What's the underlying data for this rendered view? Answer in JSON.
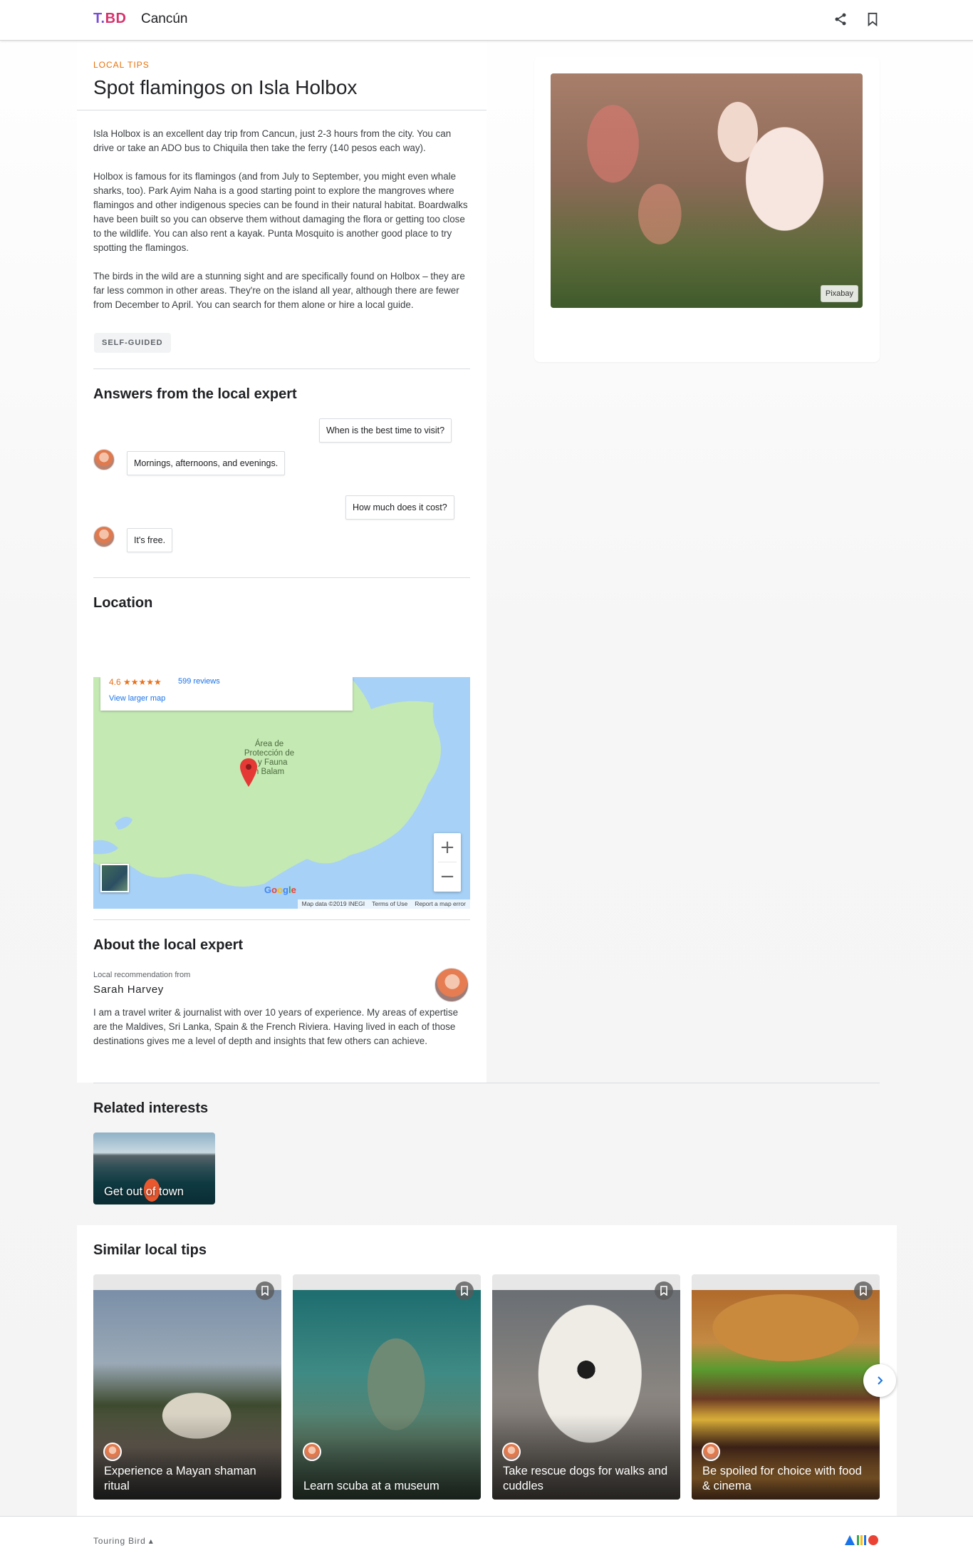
{
  "header": {
    "logo": {
      "t": "T.",
      "bd": "BD"
    },
    "city": "Cancún",
    "share_icon": "share-icon",
    "bookmark_icon": "bookmark-icon"
  },
  "article": {
    "eyebrow": "LOCAL TIPS",
    "title": "Spot flamingos on Isla Holbox",
    "paragraphs": [
      "Isla Holbox is an excellent day trip from Cancun, just 2-3 hours from the city. You can drive or take an ADO bus to Chiquila then take the ferry (140 pesos each way).",
      "Holbox is famous for its flamingos (and from July to September, you might even whale sharks, too). Park Ayim Naha is a good starting point to explore the mangroves where flamingos and other indigenous species can be found in their natural habitat. Boardwalks have been built so you can observe them without damaging the flora or getting too close to the wildlife. You can also rent a kayak. Punta Mosquito is another good place to try spotting the flamingos.",
      "The birds in the wild are a stunning sight and are specifically found on Holbox – they are far less common in other areas. They're on the island all year, although there are fewer from December to April. You can search for them alone or hire a local guide."
    ],
    "tag": "SELF-GUIDED"
  },
  "qa": {
    "title": "Answers from the local expert",
    "items": [
      {
        "q": "When is the best time to visit?",
        "a": "Mornings, afternoons, and evenings."
      },
      {
        "q": "How much does it cost?",
        "a": "It's free."
      }
    ]
  },
  "location": {
    "title": "Location",
    "rating": "4.6 ★★★★★",
    "reviews": "599 reviews",
    "larger_map": "View larger map",
    "place_lines": [
      "Área de",
      "Protección de",
      "a y Fauna",
      "n Balam"
    ],
    "google": "Google",
    "map_data": "Map data ©2019 INEGI",
    "terms": "Terms of Use",
    "report": "Report a map error",
    "zoom_in": "+",
    "zoom_out": "−"
  },
  "expert": {
    "title": "About the local expert",
    "sub": "Local recommendation from",
    "name": "Sarah Harvey",
    "bio": "I am a travel writer & journalist with over 10 years of experience. My areas of expertise are the Maldives, Sri Lanka, Spain & the French Riviera. Having lived in each of those destinations gives me a level of depth and insights that few others can achieve."
  },
  "image": {
    "credit": "Pixabay"
  },
  "related": {
    "title": "Related interests",
    "items": [
      {
        "label": "Get out of town"
      }
    ]
  },
  "similar": {
    "title": "Similar local tips",
    "items": [
      {
        "label": "Experience a Mayan shaman ritual"
      },
      {
        "label": "Learn scuba at a museum"
      },
      {
        "label": "Take rescue dogs for walks and cuddles"
      },
      {
        "label": "Be spoiled for choice with food & cinema"
      }
    ]
  },
  "footer": {
    "brand": "Touring Bird"
  },
  "colors": {
    "accent": "#e8710a",
    "link": "#1a73e8",
    "brand_purple": "#7b4fd6",
    "brand_pink": "#d6336c"
  }
}
